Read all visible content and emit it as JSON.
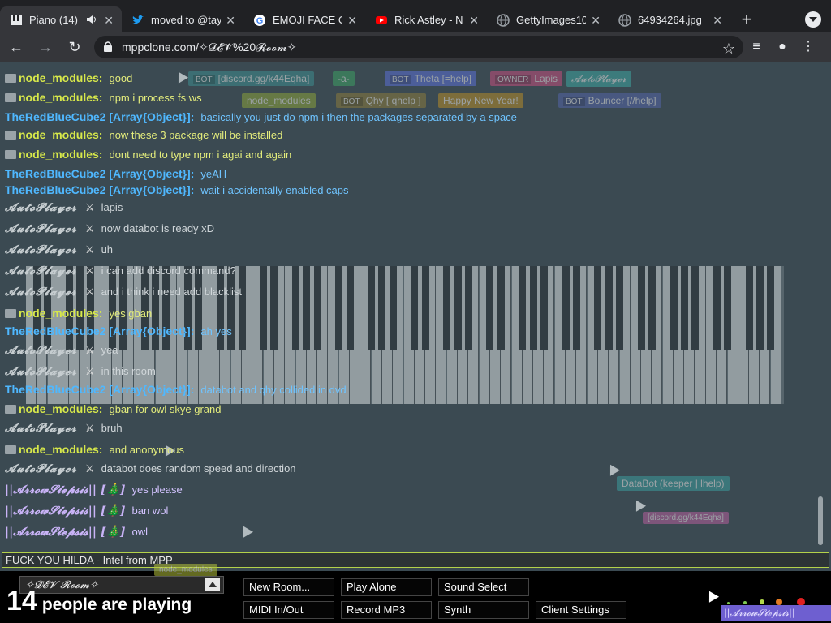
{
  "browser": {
    "tabs": [
      {
        "title": "Piano (14)",
        "active": true,
        "icon": "piano-icon"
      },
      {
        "title": "moved to @tay",
        "active": false,
        "icon": "twitter-icon"
      },
      {
        "title": "EMOJI FACE C",
        "active": false,
        "icon": "google-icon"
      },
      {
        "title": "Rick Astley - N",
        "active": false,
        "icon": "youtube-icon"
      },
      {
        "title": "GettyImages10",
        "active": false,
        "icon": "globe-icon"
      },
      {
        "title": "64934264.jpg",
        "active": false,
        "icon": "globe-icon"
      }
    ],
    "address": "mppclone.com/✧𝓓𝓔𝓥%20𝓡𝓸𝓸𝓶✧",
    "colors": {
      "tabbar": "#202124",
      "toolbar": "#35363a"
    }
  },
  "chat": {
    "messages": [
      {
        "user": "node_modules",
        "kind": "nm",
        "text": "good"
      },
      {
        "user": "node_modules",
        "kind": "nm",
        "text": "npm i process fs ws"
      },
      {
        "user": "TheRedBlueCube2 [Array{Object}]:",
        "kind": "trbc",
        "text": "basically you just do npm i then the packages separated by a space"
      },
      {
        "user": "node_modules",
        "kind": "nm",
        "text": "now these 3 package will be installed"
      },
      {
        "user": "node_modules",
        "kind": "nm",
        "text": "dont need to type npm i agai and again"
      },
      {
        "user": "TheRedBlueCube2 [Array{Object}]:",
        "kind": "trbc",
        "text": "yeAH"
      },
      {
        "user": "TheRedBlueCube2 [Array{Object}]:",
        "kind": "trbc",
        "text": "wait i accidentally enabled caps"
      },
      {
        "user": "𝓐𝓾𝓽𝓸𝓟𝓵𝓪𝔂𝓮𝓻",
        "kind": "auto",
        "text": "lapis"
      },
      {
        "user": "𝓐𝓾𝓽𝓸𝓟𝓵𝓪𝔂𝓮𝓻",
        "kind": "auto",
        "text": "now databot is ready xD"
      },
      {
        "user": "𝓐𝓾𝓽𝓸𝓟𝓵𝓪𝔂𝓮𝓻",
        "kind": "auto",
        "text": "uh"
      },
      {
        "user": "𝓐𝓾𝓽𝓸𝓟𝓵𝓪𝔂𝓮𝓻",
        "kind": "auto",
        "text": "i can add discord command?"
      },
      {
        "user": "𝓐𝓾𝓽𝓸𝓟𝓵𝓪𝔂𝓮𝓻",
        "kind": "auto",
        "text": "and i think i need add blacklist"
      },
      {
        "user": "node_modules",
        "kind": "nm",
        "text": "yes gban"
      },
      {
        "user": "TheRedBlueCube2 [Array{Object}]:",
        "kind": "trbc",
        "text": "ah yes"
      },
      {
        "user": "𝓐𝓾𝓽𝓸𝓟𝓵𝓪𝔂𝓮𝓻",
        "kind": "auto",
        "text": "yea"
      },
      {
        "user": "𝓐𝓾𝓽𝓸𝓟𝓵𝓪𝔂𝓮𝓻",
        "kind": "auto",
        "text": "in this room"
      },
      {
        "user": "TheRedBlueCube2 [Array{Object}]:",
        "kind": "trbc",
        "text": "databot and qhy collided in dvd"
      },
      {
        "user": "node_modules",
        "kind": "nm",
        "text": "gban for owl skye grand"
      },
      {
        "user": "𝓐𝓾𝓽𝓸𝓟𝓵𝓪𝔂𝓮𝓻",
        "kind": "auto",
        "text": "bruh"
      },
      {
        "user": "node_modules",
        "kind": "nm",
        "text": "and anonymous"
      },
      {
        "user": "𝓐𝓾𝓽𝓸𝓟𝓵𝓪𝔂𝓮𝓻",
        "kind": "auto",
        "text": "databot does random speed and direction"
      },
      {
        "user": "||𝓐𝓻𝓻𝓸𝔀𝓢𝓽𝓮𝓹𝓼𝓲𝓼|| [🎄]",
        "kind": "step",
        "text": "yes please"
      },
      {
        "user": "||𝓐𝓻𝓻𝓸𝔀𝓢𝓽𝓮𝓹𝓼𝓲𝓼|| [🎄]",
        "kind": "step",
        "text": "ban wol"
      },
      {
        "user": "||𝓐𝓻𝓻𝓸𝔀𝓢𝓽𝓮𝓹𝓼𝓲𝓼|| [🎄]",
        "kind": "step",
        "text": "owl"
      }
    ],
    "input_value": "FUCK YOU HILDA - Intel from MPP"
  },
  "ghost_tags": [
    {
      "text": "[discord.gg/k44Eqha]",
      "badge": "BOT",
      "color": "#3d8d8e"
    },
    {
      "text": "-a-",
      "badge": "",
      "color": "#3e9e64"
    },
    {
      "text": "Theta [=help]",
      "badge": "BOT",
      "color": "#5a6fd3"
    },
    {
      "text": "Lapis",
      "badge": "OWNER",
      "color": "#c34e7c"
    },
    {
      "text": "𝓐𝓾𝓽𝓸𝓟𝓵𝓪𝔂𝓮𝓻",
      "badge": "",
      "color": "#3da49f"
    },
    {
      "text": "node_modules",
      "badge": "",
      "color": "#8aa03c"
    },
    {
      "text": "Qhy [ qhelp ]",
      "badge": "BOT",
      "color": "#8a7b3d"
    },
    {
      "text": "Happy New Year!",
      "badge": "",
      "color": "#b38a2a"
    },
    {
      "text": "Bouncer [//help]",
      "badge": "BOT",
      "color": "#5364a6"
    },
    {
      "text": "DataBot (keeper | lhelp)",
      "badge": "",
      "color": "#3b9a9c"
    },
    {
      "text": "[discord.gg/k44Eqha]",
      "badge": "",
      "color": "#b35f9b"
    },
    {
      "text": "node_modules",
      "badge": "",
      "color": "#b4c23c"
    }
  ],
  "room": {
    "name": "✧𝓓𝓔𝓥 𝓡𝓸𝓸𝓶✧",
    "player_count": "14",
    "player_label": "people are playing"
  },
  "buttons": {
    "new_room": "New Room...",
    "play_alone": "Play Alone",
    "sound_select": "Sound Select",
    "midi": "MIDI In/Out",
    "record": "Record MP3",
    "synth": "Synth",
    "client_settings": "Client Settings"
  },
  "corner_tag": "||𝓐𝓻𝓻𝓸𝔀𝓢𝓽𝓮𝓹𝓼𝓲𝓼||",
  "colors": {
    "page_bg": "#3b4a52",
    "node_modules": "#d7e84a",
    "trbc": "#4fb8ff",
    "step": "#c9b3f7"
  }
}
